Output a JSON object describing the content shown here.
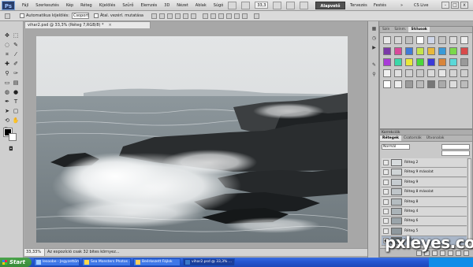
{
  "menubar": {
    "logo": "Ps",
    "items": [
      "Fájl",
      "Szerkesztés",
      "Kép",
      "Réteg",
      "Kijelölés",
      "Szűrő",
      "Elemzés",
      "3D",
      "Nézet",
      "Ablak",
      "Súgó"
    ],
    "zoom": "33,3",
    "workspaces": {
      "active": "Alapvető",
      "design": "Tervezés",
      "painting": "Festés"
    },
    "cslive": "CS Live",
    "window_buttons": [
      "-",
      "□",
      "x"
    ]
  },
  "options": {
    "auto_select_label": "Automatikus kijelölés:",
    "auto_select_value": "Csoport",
    "show_transform_label": "Átal. vezérl. mutatása"
  },
  "document": {
    "tab_title": "vihar2.psd @ 33,3% (Réteg 7,RGB/8) *",
    "tab_close": "×",
    "status_zoom": "33,33%",
    "status_info": "Az expozíció csak 32 bites környez..."
  },
  "styles_panel": {
    "tabs": [
      "Szín",
      "Színm.",
      "Stílusok"
    ],
    "active_tab": "Stílusok"
  },
  "layers_panel": {
    "header": "Korrekciók",
    "tabs": [
      "Rétegek",
      "Csatornák",
      "Útvonalak"
    ],
    "active_tab": "Rétegek",
    "blend_mode": "Normál",
    "layers": [
      {
        "name": "Réteg 2",
        "selected": false,
        "visible": false
      },
      {
        "name": "Réteg 9 másolat",
        "selected": false,
        "visible": false
      },
      {
        "name": "Réteg 9",
        "selected": false,
        "visible": false
      },
      {
        "name": "Réteg 8 másolat",
        "selected": false,
        "visible": false
      },
      {
        "name": "Réteg 8",
        "selected": false,
        "visible": false
      },
      {
        "name": "Réteg 4",
        "selected": false,
        "visible": false
      },
      {
        "name": "Réteg 6",
        "selected": false,
        "visible": false
      },
      {
        "name": "Réteg 5",
        "selected": false,
        "visible": false
      },
      {
        "name": "Háttér",
        "selected": true,
        "visible": true
      }
    ]
  },
  "taskbar": {
    "start_label": "Start",
    "tasks": [
      {
        "label": "lesoobe - Jegyzettömb",
        "active": false
      },
      {
        "label": "Sea Monsters Photos ...",
        "active": false
      },
      {
        "label": "Beérkezett Fájlok",
        "active": false
      },
      {
        "label": "vihar2.psd @ 33,3% ...",
        "active": true
      }
    ]
  },
  "watermark": "pxleyes.com",
  "colors": {
    "menubar": "#dcdcdc",
    "workspace_active": "#505050",
    "panel_bg": "#c9c9c9",
    "layer_selected": "#a9b6c8",
    "taskbar": "#2457d3",
    "start_button": "#3a8a3a",
    "foreground_color": "#000000",
    "background_color": "#ffffff"
  }
}
